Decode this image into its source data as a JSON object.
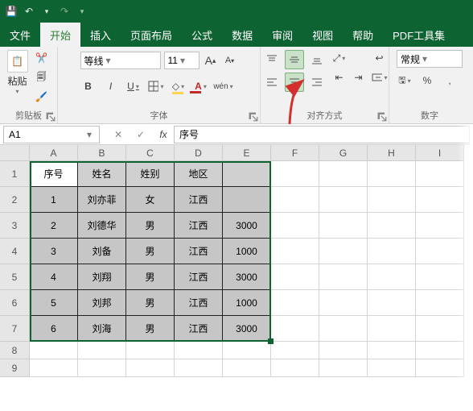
{
  "titlebar": {
    "save": "💾",
    "undo": "↶",
    "redo": "↷"
  },
  "menu": {
    "file": "文件",
    "start": "开始",
    "insert": "插入",
    "layout": "页面布局",
    "formula": "公式",
    "data": "数据",
    "review": "审阅",
    "view": "视图",
    "help": "帮助",
    "pdf": "PDF工具集"
  },
  "ribbon": {
    "clipboard": {
      "paste": "粘贴",
      "name": "剪贴板"
    },
    "font": {
      "family": "等线",
      "size": "11",
      "name": "字体",
      "bold": "B",
      "italic": "I",
      "underline": "U",
      "wen": "wén",
      "Aup": "A",
      "Adn": "A"
    },
    "align": {
      "name": "对齐方式"
    },
    "number": {
      "format": "常规",
      "percent": "%",
      "name": "数字"
    }
  },
  "namebox": {
    "ref": "A1"
  },
  "formula": {
    "fx": "fx",
    "value": "序号"
  },
  "cols": [
    "A",
    "B",
    "C",
    "D",
    "E",
    "F",
    "G",
    "H",
    "I"
  ],
  "rows": [
    "1",
    "2",
    "3",
    "4",
    "5",
    "6",
    "7",
    "8",
    "9"
  ],
  "chart_data": {
    "type": "table",
    "headers": [
      "序号",
      "姓名",
      "姓别",
      "地区",
      ""
    ],
    "rows": [
      [
        "1",
        "刘亦菲",
        "女",
        "江西",
        ""
      ],
      [
        "2",
        "刘德华",
        "男",
        "江西",
        "3000"
      ],
      [
        "3",
        "刘备",
        "男",
        "江西",
        "1000"
      ],
      [
        "4",
        "刘翔",
        "男",
        "江西",
        "3000"
      ],
      [
        "5",
        "刘邦",
        "男",
        "江西",
        "1000"
      ],
      [
        "6",
        "刘海",
        "男",
        "江西",
        "3000"
      ]
    ]
  }
}
